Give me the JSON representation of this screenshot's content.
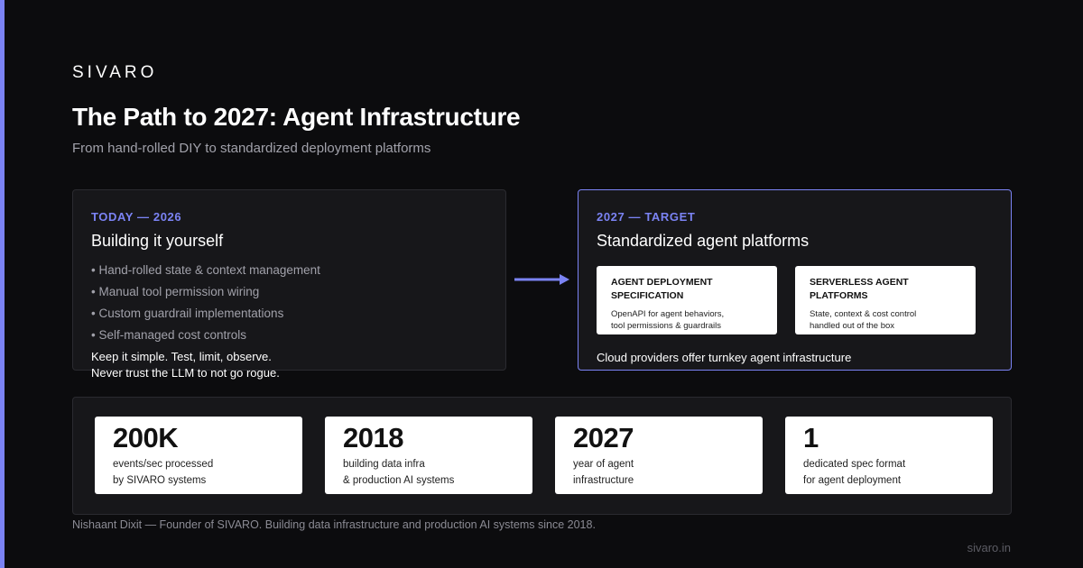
{
  "brand": "SIVARO",
  "title": "The Path to 2027: Agent Infrastructure",
  "subtitle": "From hand-rolled DIY to standardized deployment platforms",
  "colors": {
    "accent": "#7b83f4",
    "background": "#0c0c0e",
    "card": "#17171a"
  },
  "left_card": {
    "eyebrow": "TODAY — 2026",
    "title": "Building it yourself",
    "bullets": [
      "• Hand-rolled state & context management",
      "• Manual tool permission wiring",
      "• Custom guardrail implementations",
      "• Self-managed cost controls"
    ],
    "note_line1": "Keep it simple. Test, limit, observe.",
    "note_line2": "Never trust the LLM to not go rogue."
  },
  "arrow_icon": "arrow-right-icon",
  "right_card": {
    "eyebrow": "2027 — TARGET",
    "title": "Standardized agent platforms",
    "boxes": [
      {
        "title_line1": "AGENT DEPLOYMENT",
        "title_line2": "SPECIFICATION",
        "desc_line1": "OpenAPI for agent behaviors,",
        "desc_line2": "tool permissions & guardrails"
      },
      {
        "title_line1": "SERVERLESS AGENT",
        "title_line2": "PLATFORMS",
        "desc_line1": "State, context & cost control",
        "desc_line2": "handled out of the box"
      }
    ],
    "footer": "Cloud providers offer turnkey agent infrastructure"
  },
  "stats": [
    {
      "value": "200K",
      "label_line1": "events/sec processed",
      "label_line2": "by SIVARO systems"
    },
    {
      "value": "2018",
      "label_line1": "building data infra",
      "label_line2": "& production AI systems"
    },
    {
      "value": "2027",
      "label_line1": "year of agent",
      "label_line2": "infrastructure"
    },
    {
      "value": "1",
      "label_line1": "dedicated spec format",
      "label_line2": "for agent deployment"
    }
  ],
  "footer_note": "Nishaant Dixit — Founder of SIVARO. Building data infrastructure and production AI systems since 2018.",
  "site": "sivaro.in"
}
